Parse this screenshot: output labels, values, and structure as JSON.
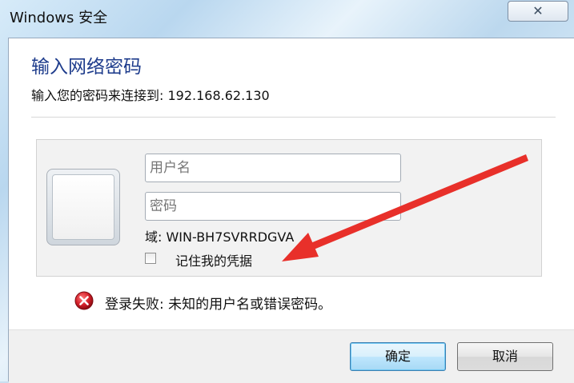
{
  "window": {
    "title": "Windows 安全",
    "close_symbol": "✕"
  },
  "dialog": {
    "heading": "输入网络密码",
    "subheading": "输入您的密码来连接到: 192.168.62.130"
  },
  "credentials": {
    "username_placeholder": "用户名",
    "password_placeholder": "密码",
    "domain_label": "域: WIN-BH7SVRRDGVA",
    "remember_label": "记住我的凭据",
    "remember_checked": false
  },
  "error": {
    "message": "登录失败: 未知的用户名或错误密码。",
    "icon": "error-icon"
  },
  "buttons": {
    "ok_label": "确定",
    "cancel_label": "取消"
  },
  "colors": {
    "heading": "#1e3c8c",
    "error_icon": "#c8102e",
    "annotation_arrow": "#e8302a"
  }
}
